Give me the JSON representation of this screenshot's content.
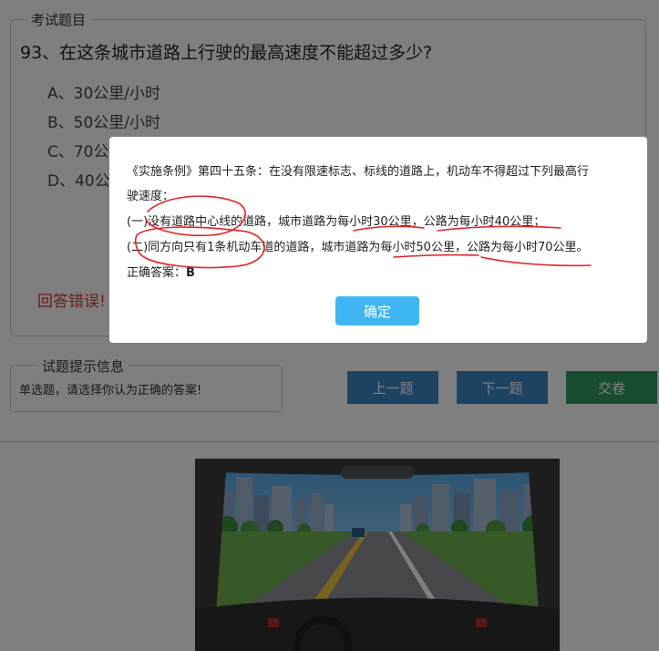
{
  "question_section": {
    "legend": "考试题目",
    "question": "93、在这条城市道路上行驶的最高速度不能超过多少?",
    "options": [
      "A、30公里/小时",
      "B、50公里/小时",
      "C、70公",
      "D、40公"
    ],
    "result": "回答错误!"
  },
  "hint_section": {
    "legend": "试题提示信息",
    "text": "单选题，请选择你认为正确的答案!"
  },
  "buttons": {
    "prev": "上一题",
    "next": "下一题",
    "submit": "交卷"
  },
  "dialog": {
    "line1": "《实施条例》第四十五条：在没有限速标志、标线的道路上，机动车不得超过下列最高行",
    "line2": "驶速度：",
    "line3": "(一)没有道路中心线的道路，城市道路为每小时30公里，公路为每小时40公里；",
    "line4": "(二)同方向只有1条机动车道的道路，城市道路为每小时50公里，公路为每小时70公里。",
    "answer_label": "正确答案：",
    "answer_value": "B",
    "ok": "确定"
  },
  "colors": {
    "nav_button": "#3a86c6",
    "submit_button": "#2f9b5c",
    "error_text": "#d9363e",
    "ok_button": "#3fb6f2",
    "annotation": "#e0232a"
  }
}
